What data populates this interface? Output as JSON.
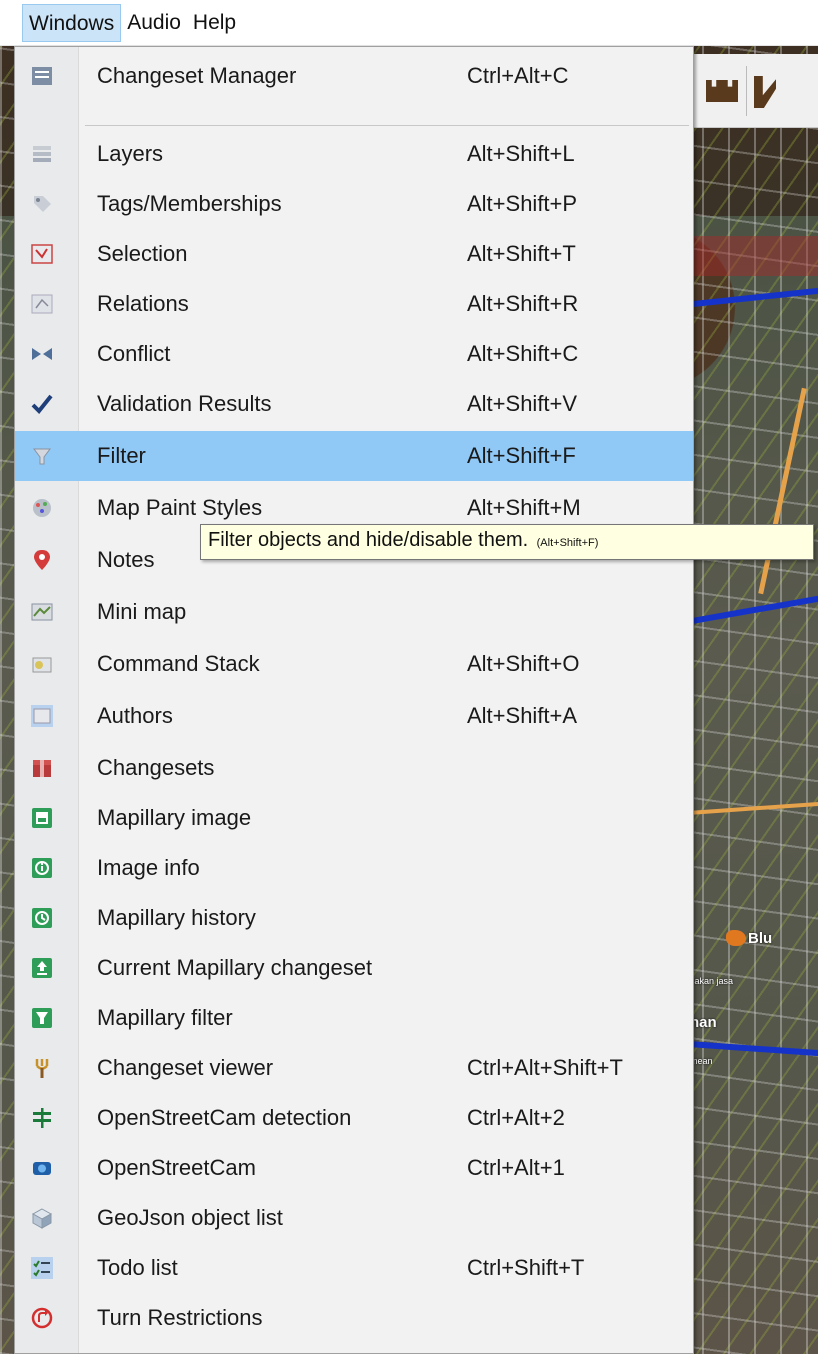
{
  "menubar": {
    "items": [
      {
        "label": "Windows",
        "active": true
      },
      {
        "label": "Audio"
      },
      {
        "label": "Help"
      }
    ]
  },
  "menu": {
    "items": [
      {
        "label": "Changeset Manager",
        "shortcut": "Ctrl+Alt+C",
        "icon": "changeset-manager-icon"
      },
      {
        "label": "Layers",
        "shortcut": "Alt+Shift+L",
        "icon": "layers-icon"
      },
      {
        "label": "Tags/Memberships",
        "shortcut": "Alt+Shift+P",
        "icon": "tags-icon"
      },
      {
        "label": "Selection",
        "shortcut": "Alt+Shift+T",
        "icon": "selection-icon"
      },
      {
        "label": "Relations",
        "shortcut": "Alt+Shift+R",
        "icon": "relations-icon"
      },
      {
        "label": "Conflict",
        "shortcut": "Alt+Shift+C",
        "icon": "conflict-icon"
      },
      {
        "label": "Validation Results",
        "shortcut": "Alt+Shift+V",
        "icon": "checkmark-icon"
      },
      {
        "label": "Filter",
        "shortcut": "Alt+Shift+F",
        "icon": "filter-icon",
        "highlighted": true
      },
      {
        "label": "Map Paint Styles",
        "shortcut": "Alt+Shift+M",
        "icon": "paint-styles-icon"
      },
      {
        "label": "Notes",
        "shortcut": "",
        "icon": "notes-pin-icon"
      },
      {
        "label": "Mini map",
        "shortcut": "",
        "icon": "mini-map-icon"
      },
      {
        "label": "Command Stack",
        "shortcut": "Alt+Shift+O",
        "icon": "command-stack-icon"
      },
      {
        "label": "Authors",
        "shortcut": "Alt+Shift+A",
        "icon": "authors-icon"
      },
      {
        "label": "Changesets",
        "shortcut": "",
        "icon": "changesets-box-icon"
      },
      {
        "label": "Mapillary image",
        "shortcut": "",
        "icon": "mapillary-image-icon"
      },
      {
        "label": "Image info",
        "shortcut": "",
        "icon": "info-icon"
      },
      {
        "label": "Mapillary history",
        "shortcut": "",
        "icon": "history-icon"
      },
      {
        "label": "Current Mapillary changeset",
        "shortcut": "",
        "icon": "upload-icon"
      },
      {
        "label": "Mapillary filter",
        "shortcut": "",
        "icon": "mapillary-filter-icon"
      },
      {
        "label": "Changeset viewer",
        "shortcut": "Ctrl+Alt+Shift+T",
        "icon": "changeset-viewer-icon"
      },
      {
        "label": "OpenStreetCam detection",
        "shortcut": "Ctrl+Alt+2",
        "icon": "sign-post-icon"
      },
      {
        "label": "OpenStreetCam",
        "shortcut": "Ctrl+Alt+1",
        "icon": "camera-icon"
      },
      {
        "label": "GeoJson object list",
        "shortcut": "",
        "icon": "cube-icon"
      },
      {
        "label": "Todo list",
        "shortcut": "Ctrl+Shift+T",
        "icon": "todo-list-icon"
      },
      {
        "label": "Turn Restrictions",
        "shortcut": "",
        "icon": "turn-restriction-icon"
      }
    ]
  },
  "tooltip": {
    "text": "Filter objects and hide/disable them.",
    "shortcut": "(Alt+Shift+F)"
  },
  "map": {
    "labels": {
      "blu": "Blu",
      "han": "han",
      "small": "sakan jasa",
      "mean": "mean"
    }
  },
  "colors": {
    "menu_highlight": "#90c8f6",
    "menubar_active": "#cce4f7",
    "tooltip_bg": "#ffffe1"
  }
}
